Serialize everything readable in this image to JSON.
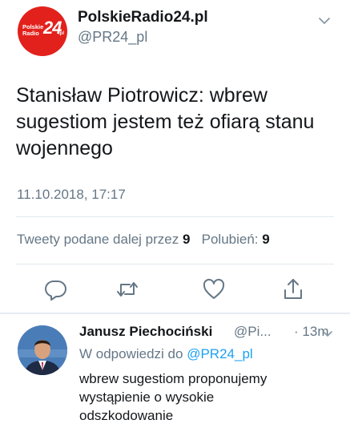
{
  "tweet": {
    "avatar_text": {
      "line1": "Polskie",
      "line2": "Radio",
      "number": "24",
      "suffix": ".pl"
    },
    "display_name": "PolskieRadio24.pl",
    "handle": "@PR24_pl",
    "text": "Stanisław Piotrowicz: wbrew\nsugestiom jestem też ofiarą stanu\nwojennego",
    "timestamp": "11.10.2018, 17:17",
    "retweets_label": "Tweety podane dalej przez",
    "retweets_count": "9",
    "likes_label": "Polubień:",
    "likes_count": "9",
    "actions": [
      {
        "icon": "reply-icon"
      },
      {
        "icon": "retweet-icon"
      },
      {
        "icon": "like-icon"
      },
      {
        "icon": "share-icon"
      }
    ]
  },
  "reply": {
    "display_name": "Janusz Piechociński",
    "handle": "@Pi...",
    "separator": "·",
    "time": "13m",
    "reply_to_label": "W odpowiedzi do",
    "reply_to_handle": "@PR24_pl",
    "text": "wbrew sugestiom  proponujemy\nwystąpienie o wysokie\nodszkodowanie"
  },
  "colors": {
    "accent": "#1da1f2",
    "brand": "#e2211c",
    "secondary_text": "#657786",
    "icon": "#657786"
  }
}
